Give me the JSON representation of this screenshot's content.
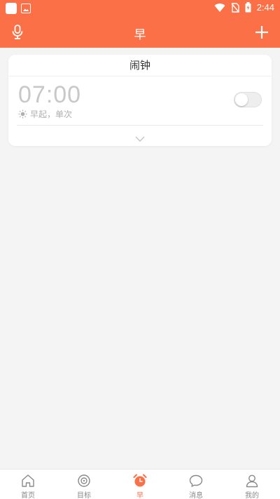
{
  "status_bar": {
    "time": "2:44"
  },
  "app_bar": {
    "title": "早",
    "left_icon": "mic-icon",
    "right_icon": "plus-icon"
  },
  "alarm_card": {
    "header": "闹钟",
    "time": "07:00",
    "subtitle": "早起，单次",
    "enabled": false
  },
  "bottom_nav": {
    "items": [
      {
        "label": "首页",
        "icon": "home-icon",
        "active": false
      },
      {
        "label": "目标",
        "icon": "target-icon",
        "active": false
      },
      {
        "label": "早",
        "icon": "alarm-clock-icon",
        "active": true
      },
      {
        "label": "消息",
        "icon": "message-icon",
        "active": false
      },
      {
        "label": "我的",
        "icon": "user-icon",
        "active": false
      }
    ]
  },
  "colors": {
    "accent": "#fb7046",
    "background": "#f4f4f4",
    "inactive": "#8a8a8a"
  }
}
